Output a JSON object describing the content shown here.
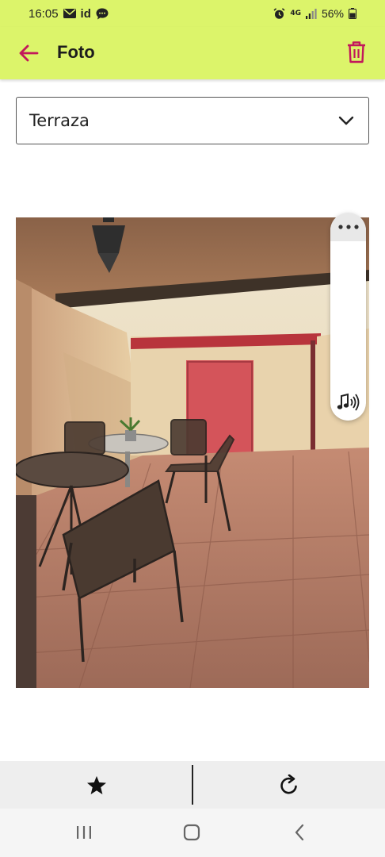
{
  "status_bar": {
    "time": "16:05",
    "left_icons": [
      "mail-icon",
      "id-icon",
      "chat-icon"
    ],
    "id_text": "id",
    "network_label": "4G",
    "battery_percent": "56%",
    "right_icons": [
      "alarm-icon",
      "network-4g-icon",
      "signal-icon",
      "battery-icon"
    ]
  },
  "app_bar": {
    "title": "Foto",
    "back_icon": "arrow-left-icon",
    "delete_icon": "trash-icon",
    "background_color": "#dcf46a",
    "icon_color": "#c2185b"
  },
  "category_select": {
    "selected": "Terraza",
    "icon": "chevron-down-icon"
  },
  "photo": {
    "subject": "Terraza"
  },
  "floating_panel": {
    "more_icon": "more-horizontal-icon",
    "sound_icon": "music-sound-icon"
  },
  "action_bar": {
    "favorite_icon": "star-icon",
    "rotate_icon": "rotate-icon"
  },
  "nav_bar": {
    "recents_icon": "recents-icon",
    "home_icon": "home-icon",
    "back_icon": "nav-back-icon"
  }
}
